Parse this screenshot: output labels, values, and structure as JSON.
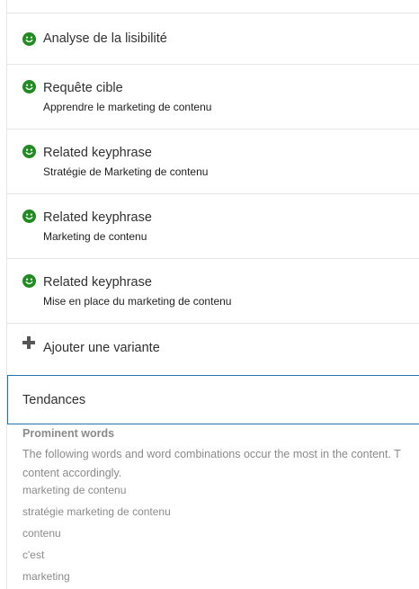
{
  "colors": {
    "good": "#1e8c1e",
    "focus": "#2271b1",
    "muted": "#8a8a8a"
  },
  "analysis": {
    "readability": {
      "icon": "smiley-good-icon",
      "title": "Analyse de la lisibilité"
    },
    "focus": {
      "icon": "smiley-good-icon",
      "title": "Requête cible",
      "keyphrase": "Apprendre le marketing de contenu"
    },
    "related": [
      {
        "icon": "smiley-good-icon",
        "title": "Related keyphrase",
        "keyphrase": "Stratégie de Marketing de contenu"
      },
      {
        "icon": "smiley-good-icon",
        "title": "Related keyphrase",
        "keyphrase": "Marketing de contenu"
      },
      {
        "icon": "smiley-good-icon",
        "title": "Related keyphrase",
        "keyphrase": "Mise en place du marketing de contenu"
      }
    ],
    "add_variant": {
      "icon": "plus-icon",
      "label": "Ajouter une variante"
    }
  },
  "insights": {
    "title": "Tendances",
    "prominent_words": {
      "heading": "Prominent words",
      "desc_line1": "The following words and word combinations occur the most in the content. T",
      "desc_line2": "content accordingly.",
      "words": [
        "marketing de contenu",
        "stratégie marketing de contenu",
        "contenu",
        "c'est",
        "marketing"
      ]
    }
  }
}
